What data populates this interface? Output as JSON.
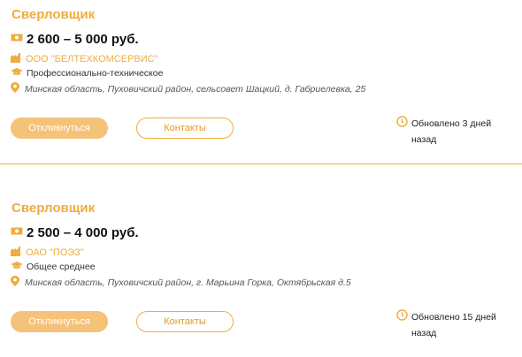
{
  "vacancies": [
    {
      "title": "Сверловщик",
      "salary": "2 600 – 5 000 руб.",
      "company": "ООО \"БЕЛТЕХКОМСЕРВИС\"",
      "education": "Профессионально-техническое",
      "address": "Минская область, Пуховичский район, сельсовет Шацкий, д. Габриелевка, 25",
      "respond_label": "Откликнуться",
      "contacts_label": "Контакты",
      "updated": "Обновлено 3 дней назад"
    },
    {
      "title": "Сверловщик",
      "salary": "2 500 – 4 000 руб.",
      "company": "ОАО \"ПОЭЗ\"",
      "education": "Общее среднее",
      "address": "Минская область, Пуховичский район, г. Марьина Горка, Октябрьская д.5",
      "respond_label": "Откликнуться",
      "contacts_label": "Контакты",
      "updated": "Обновлено 15 дней назад"
    }
  ],
  "colors": {
    "accent": "#f0ad3c",
    "button_fill": "#f5c27a"
  },
  "icons": [
    "money-icon",
    "building-icon",
    "graduation-cap-icon",
    "location-pin-icon",
    "clock-icon"
  ]
}
